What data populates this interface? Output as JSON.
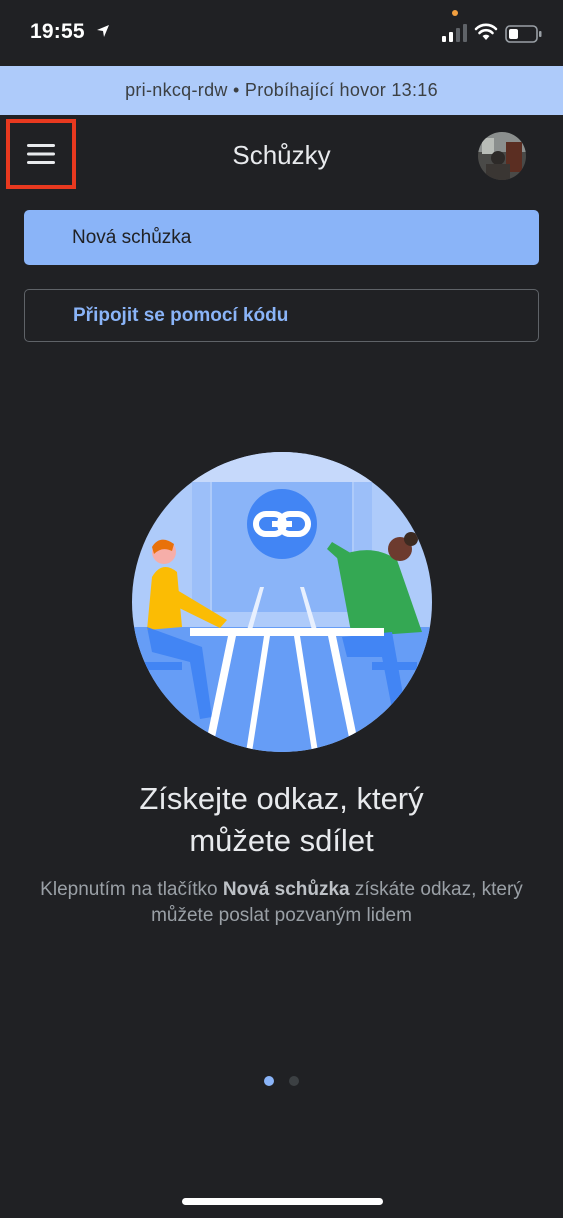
{
  "status_bar": {
    "time": "19:55"
  },
  "call_banner": {
    "text": "pri-nkcq-rdw • Probíhající hovor 13:16"
  },
  "header": {
    "title": "Schůzky",
    "menu_icon": "hamburger-menu-icon",
    "avatar": "user-avatar"
  },
  "buttons": {
    "new_meeting": "Nová schůzka",
    "join_with_code": "Připojit se pomocí kódu"
  },
  "onboarding": {
    "heading_line1": "Získejte odkaz, který",
    "heading_line2": "můžete sdílet",
    "sub_part1": "Klepnutím na tlačítko ",
    "sub_bold": "Nová schůzka",
    "sub_part2": " získáte odkaz, který můžete poslat pozvaným lidem"
  },
  "pager": {
    "total": 2,
    "active": 1
  },
  "colors": {
    "background": "#202124",
    "accent": "#8ab4f8",
    "banner": "#aecbfa",
    "highlight_frame": "#e8391f"
  }
}
